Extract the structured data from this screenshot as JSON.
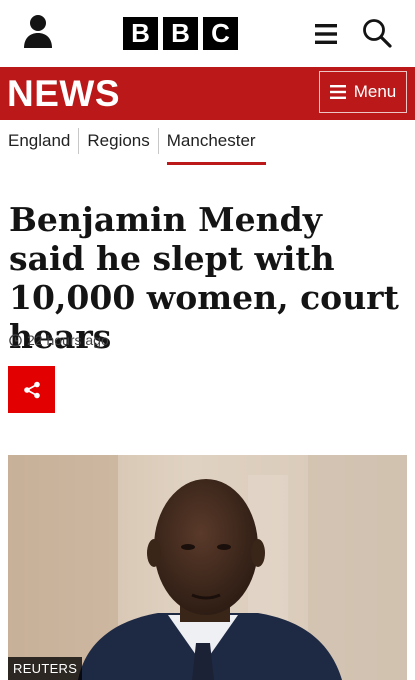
{
  "header": {
    "logo_letters": [
      "B",
      "B",
      "C"
    ],
    "icons": [
      "user-icon",
      "hamburger-icon",
      "search-icon"
    ]
  },
  "news_bar": {
    "title": "NEWS",
    "menu_label": "Menu",
    "color": "#bb1919"
  },
  "nav": {
    "items": [
      {
        "label": "England"
      },
      {
        "label": "Regions"
      },
      {
        "label": "Manchester",
        "active": true
      }
    ]
  },
  "article": {
    "headline": "Benjamin Mendy said he slept with 10,000 women, court hears",
    "timestamp": "22 hours ago",
    "share_icon": "share-icon",
    "share_color": "#e20000",
    "photo_credit": "REUTERS"
  }
}
